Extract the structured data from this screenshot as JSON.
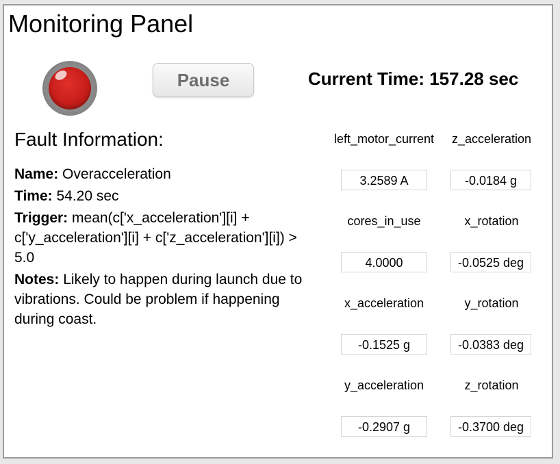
{
  "header": {
    "title": "Monitoring Panel",
    "pause_label": "Pause",
    "current_time": "Current Time: 157.28 sec"
  },
  "status_light": {
    "state": "fault",
    "color": "#d0241e"
  },
  "fault": {
    "heading": "Fault Information:",
    "name_key": "Name:",
    "name_value": "Overacceleration",
    "time_key": "Time:",
    "time_value": "54.20 sec",
    "trigger_key": "Trigger:",
    "trigger_value": "mean(c['x_acceleration'][i] + c['y_acceleration'][i] + c['z_acceleration'][i]) > 5.0",
    "notes_key": "Notes:",
    "notes_value": "Likely to happen during launch due to vibrations. Could be problem if happening during coast."
  },
  "sensors": [
    {
      "label": "left_motor_current",
      "value": "3.2589 A"
    },
    {
      "label": "z_acceleration",
      "value": "-0.0184 g"
    },
    {
      "label": "cores_in_use",
      "value": "4.0000"
    },
    {
      "label": "x_rotation",
      "value": "-0.0525 deg"
    },
    {
      "label": "x_acceleration",
      "value": "-0.1525 g"
    },
    {
      "label": "y_rotation",
      "value": "-0.0383 deg"
    },
    {
      "label": "y_acceleration",
      "value": "-0.2907 g"
    },
    {
      "label": "z_rotation",
      "value": "-0.3700 deg"
    }
  ]
}
